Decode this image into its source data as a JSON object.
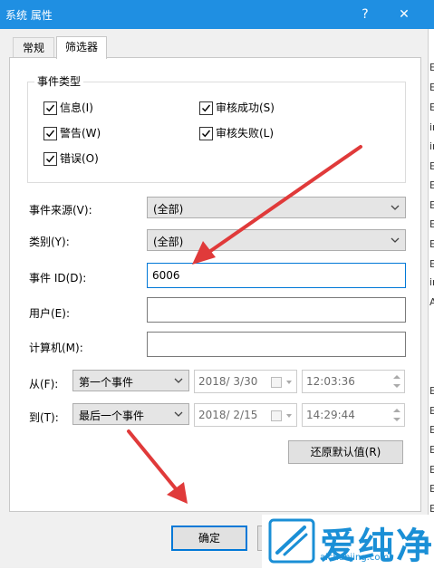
{
  "window": {
    "title": "系统 属性",
    "help_glyph": "?",
    "close_glyph": "✕"
  },
  "tabs": [
    {
      "label": "常规"
    },
    {
      "label": "筛选器"
    }
  ],
  "event_types": {
    "legend": "事件类型",
    "items": [
      {
        "label": "信息(I)",
        "checked": true
      },
      {
        "label": "审核成功(S)",
        "checked": true
      },
      {
        "label": "警告(W)",
        "checked": true
      },
      {
        "label": "审核失败(L)",
        "checked": true
      },
      {
        "label": "错误(O)",
        "checked": true
      }
    ]
  },
  "fields": {
    "source": {
      "label": "事件来源(V):",
      "value": "(全部)"
    },
    "category": {
      "label": "类别(Y):",
      "value": "(全部)"
    },
    "event_id": {
      "label": "事件 ID(D):",
      "value": "6006"
    },
    "user": {
      "label": "用户(E):",
      "value": ""
    },
    "computer": {
      "label": "计算机(M):",
      "value": ""
    }
  },
  "from": {
    "label": "从(F):",
    "mode": "第一个事件",
    "date": "2018/  3/30",
    "time": "12:03:36"
  },
  "to": {
    "label": "到(T):",
    "mode": "最后一个事件",
    "date": "2018/  2/15",
    "time": "14:29:44"
  },
  "buttons": {
    "restore_defaults": "还原默认值(R)",
    "ok": "确定"
  },
  "background_window": {
    "row_letters": [
      "E",
      "E",
      "E",
      "ir",
      "ir",
      "E",
      "E",
      "E",
      "E",
      "E",
      "E",
      "ir",
      "A",
      "E",
      "E",
      "E",
      "E",
      "E",
      "E",
      "E",
      "E",
      "E"
    ]
  },
  "watermark": {
    "text": "爱纯净",
    "url": "aichunjing.com"
  },
  "colors": {
    "titlebar": "#1f8fe2",
    "arrow": "#e03a3a",
    "focus_border": "#0078d7",
    "watermark": "#1a8fd6"
  }
}
